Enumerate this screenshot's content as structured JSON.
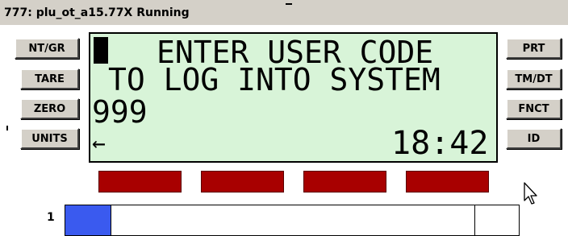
{
  "window": {
    "title": "777: plu_ot_a15.77X Running"
  },
  "left_buttons": [
    {
      "label": "NT/GR"
    },
    {
      "label": "TARE"
    },
    {
      "label": "ZERO"
    },
    {
      "label": "UNITS"
    }
  ],
  "right_buttons": [
    {
      "label": "PRT"
    },
    {
      "label": "TM/DT"
    },
    {
      "label": "FNCT"
    },
    {
      "label": "ID"
    }
  ],
  "display": {
    "line1": "ENTER USER CODE",
    "line2": "TO LOG INTO SYSTEM",
    "entry": "999",
    "back_arrow": "←",
    "time": "18:42",
    "background_color": "#d8f4d8"
  },
  "soft_keys": {
    "count": 4,
    "color": "#a80000"
  },
  "status_bar": {
    "row_number": "1",
    "fill_color": "#3a5aef"
  },
  "icons": {
    "cursor": "mouse-pointer-icon",
    "lcd_cursor": "block-cursor-icon"
  }
}
